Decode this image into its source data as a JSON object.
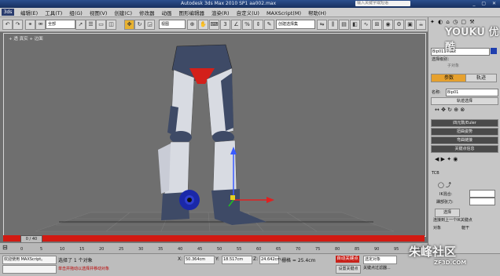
{
  "window": {
    "title": "Autodesk 3ds Max  2010 SP1     aa002.max",
    "search_placeholder": "输入关键字或短语",
    "controls": "_ ▢ ✕"
  },
  "menu": {
    "logo": "3ds",
    "items": [
      "编辑(E)",
      "工具(T)",
      "组(G)",
      "视图(V)",
      "创建(C)",
      "修改器",
      "动画",
      "图形编辑器",
      "渲染(R)",
      "自定义(U)",
      "MAXScript(M)",
      "帮助(H)"
    ]
  },
  "toolbar": {
    "filter_select": "全部",
    "coord_select": "视图",
    "named_sel": "创建选择集"
  },
  "viewport": {
    "label": "+ 透 真实 + 边面"
  },
  "timeline": {
    "slider_text": "0 / 40",
    "ticks": [
      "0",
      "5",
      "10",
      "15",
      "20",
      "25",
      "30",
      "35",
      "40",
      "45",
      "50",
      "55",
      "60",
      "65",
      "70",
      "75",
      "80",
      "85",
      "90",
      "95",
      "100"
    ]
  },
  "status": {
    "script_line1": "欢迎使用 MAXScript。",
    "script_line2": "",
    "selected": "选择了 1 个对象",
    "hint": "单击并拖动以选择并移动对象",
    "x_label": "X:",
    "x_value": "50.364cm",
    "y_label": "Y:",
    "y_value": "18.517cm",
    "z_label": "Z:",
    "z_value": "24.642cm",
    "grid": "栅格 = 25.4cm",
    "autokey": "自动关键点",
    "setkey": "设置关键点",
    "selset": "选定对象",
    "keyfilter": "关键点过滤器..."
  },
  "command_panel": {
    "object_name": "Bip011 Foot",
    "modifier_list": "选择级别：",
    "sub_object": "子对象",
    "tab_params": "参数",
    "tab_track": "轨迹",
    "name_label": "名称:",
    "name_value": "Bip01",
    "rollout_track_select": "轨迹选择",
    "rollout_quat": "四元数/Euler",
    "rollout_twist": "扭曲姿势",
    "rollout_bend": "弯曲链接",
    "rollout_keyinfo": "关键点信息",
    "tcb": "TCB",
    "ik_blend": "IK混合:",
    "ankle_tension": "踝部张力:",
    "select_btn": "选择",
    "chk_join": "连接到上一个IK关键点",
    "chk_object": "对象",
    "chk_body": "躯干"
  },
  "watermarks": {
    "youku": "YOUKU 优酷",
    "zf3d": "朱峰社区",
    "zf3d_url": "ZF3D.COM"
  },
  "colors": {
    "autokey": "#c8211a",
    "timeline": "#d21a12",
    "active_tab": "#e6a12e",
    "swatch": "#1f3fae"
  }
}
